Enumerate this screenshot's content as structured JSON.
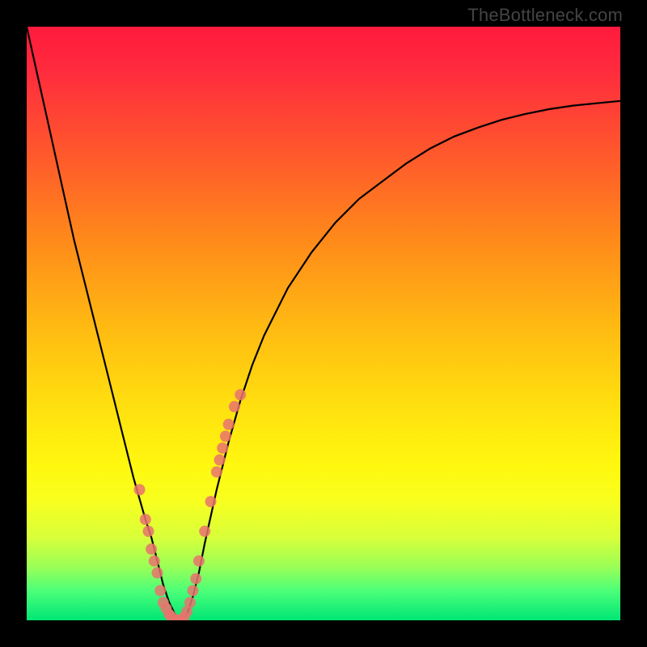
{
  "watermark": "TheBottleneck.com",
  "colors": {
    "frame": "#000000",
    "gradient_top": "#ff1a3d",
    "gradient_bottom": "#00e676",
    "curve": "#000000",
    "dot": "#e9736d"
  },
  "chart_data": {
    "type": "line",
    "title": "",
    "xlabel": "",
    "ylabel": "",
    "xlim": [
      0,
      100
    ],
    "ylim": [
      0,
      100
    ],
    "x": [
      0,
      2,
      4,
      6,
      8,
      10,
      12,
      14,
      16,
      18,
      20,
      21,
      22,
      23,
      24,
      25,
      26,
      27,
      28,
      29,
      30,
      32,
      34,
      36,
      38,
      40,
      44,
      48,
      52,
      56,
      60,
      64,
      68,
      72,
      76,
      80,
      84,
      88,
      92,
      96,
      100
    ],
    "values": [
      100,
      91,
      82,
      73,
      64,
      56,
      48,
      40,
      32,
      24,
      17,
      14,
      10,
      6,
      3,
      1,
      0,
      1,
      4,
      8,
      13,
      22,
      30,
      37,
      43,
      48,
      56,
      62,
      67,
      71,
      74,
      77,
      79.5,
      81.5,
      83,
      84.3,
      85.3,
      86.1,
      86.7,
      87.1,
      87.5
    ],
    "annotations": {
      "scatter_points_x": [
        19,
        20,
        20.5,
        21,
        21.5,
        22,
        22.5,
        23,
        23.5,
        24,
        24.5,
        25,
        25.5,
        26,
        26.5,
        27,
        27.5,
        28,
        28.5,
        29,
        30,
        31,
        32,
        32.5,
        33,
        33.5,
        34,
        35,
        36
      ],
      "scatter_points_y": [
        22,
        17,
        15,
        12,
        10,
        8,
        5,
        3,
        2,
        1,
        0.5,
        0,
        0,
        0,
        0.5,
        1.5,
        3,
        5,
        7,
        10,
        15,
        20,
        25,
        27,
        29,
        31,
        33,
        36,
        38
      ],
      "description": "Cluster of pink-red dots near the valley of the curve"
    },
    "background": "vertical heatmap gradient red-yellow-green"
  }
}
